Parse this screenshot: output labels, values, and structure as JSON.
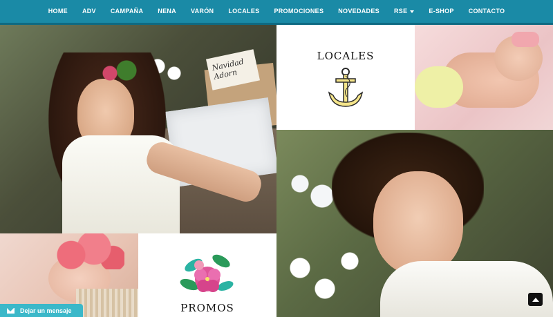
{
  "nav": {
    "items": [
      {
        "label": "HOME"
      },
      {
        "label": "ADV"
      },
      {
        "label": "CAMPAÑA"
      },
      {
        "label": "NENA"
      },
      {
        "label": "VARÓN"
      },
      {
        "label": "LOCALES"
      },
      {
        "label": "PROMOCIONES"
      },
      {
        "label": "NOVEDADES"
      },
      {
        "label": "RSE",
        "has_dropdown": true
      },
      {
        "label": "E-SHOP"
      },
      {
        "label": "CONTACTO"
      }
    ]
  },
  "tiles": {
    "locales": {
      "title": "LOCALES",
      "icon": "anchor-icon"
    },
    "promos": {
      "title": "PROMOS",
      "icon": "hibiscus-flower-icon"
    },
    "gift_tag_text": "Navidad Adorn"
  },
  "floating": {
    "message_label": "Dejar un mensaje",
    "message_icon": "envelope-icon",
    "scroll_top_icon": "arrow-up-icon"
  },
  "colors": {
    "nav_bg": "#1a8aa6",
    "message_bg": "#3bb8c9",
    "anchor_yellow": "#f5e58a",
    "hibiscus_pink": "#e0569a"
  }
}
